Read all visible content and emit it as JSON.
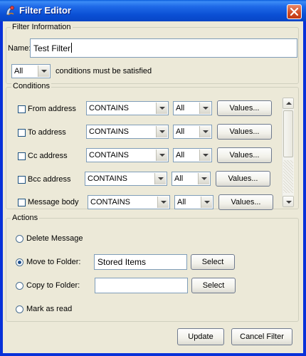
{
  "window": {
    "title": "Filter Editor"
  },
  "filter_info": {
    "group_label": "Filter Information",
    "name_label": "Name:",
    "name_value": "Test Filter",
    "match_select": "All",
    "match_text": "conditions must be satisfied"
  },
  "conditions": {
    "group_label": "Conditions",
    "rows": [
      {
        "label": "From address",
        "operator": "CONTAINS",
        "quantifier": "All",
        "values_label": "Values..."
      },
      {
        "label": "To address",
        "operator": "CONTAINS",
        "quantifier": "All",
        "values_label": "Values..."
      },
      {
        "label": "Cc address",
        "operator": "CONTAINS",
        "quantifier": "All",
        "values_label": "Values..."
      },
      {
        "label": "Bcc address",
        "operator": "CONTAINS",
        "quantifier": "All",
        "values_label": "Values..."
      },
      {
        "label": "Message body",
        "operator": "CONTAINS",
        "quantifier": "All",
        "values_label": "Values..."
      }
    ]
  },
  "actions": {
    "group_label": "Actions",
    "delete_label": "Delete Message",
    "move_label": "Move to Folder:",
    "move_value": "Stored Items",
    "move_select_label": "Select",
    "copy_label": "Copy to Folder:",
    "copy_value": "",
    "copy_select_label": "Select",
    "mark_read_label": "Mark as read",
    "selected": "move"
  },
  "footer": {
    "update_label": "Update",
    "cancel_label": "Cancel Filter"
  }
}
